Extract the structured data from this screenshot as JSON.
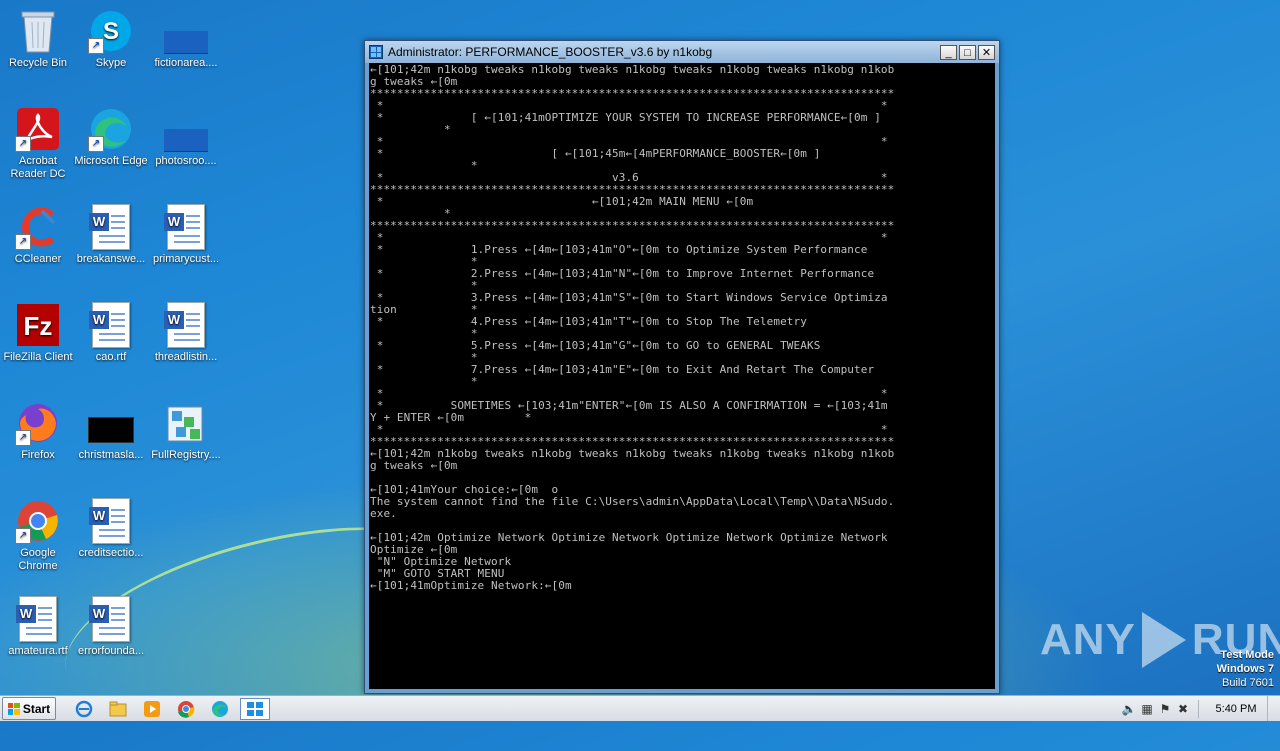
{
  "desktop": {
    "icons": [
      {
        "label": "Recycle Bin",
        "icon": "recycle-bin-icon"
      },
      {
        "label": "Skype",
        "icon": "skype-icon"
      },
      {
        "label": "fictionarea....",
        "icon": "blank-file-icon"
      },
      {
        "label": "Acrobat Reader DC",
        "icon": "acrobat-icon"
      },
      {
        "label": "Microsoft Edge",
        "icon": "edge-icon"
      },
      {
        "label": "photosroo....",
        "icon": "blank-file-icon"
      },
      {
        "label": "CCleaner",
        "icon": "ccleaner-icon"
      },
      {
        "label": "breakanswe...",
        "icon": "word-doc-icon"
      },
      {
        "label": "primarycust...",
        "icon": "word-doc-icon"
      },
      {
        "label": "FileZilla Client",
        "icon": "filezilla-icon"
      },
      {
        "label": "cao.rtf",
        "icon": "word-doc-icon"
      },
      {
        "label": "threadlistin...",
        "icon": "word-doc-icon"
      },
      {
        "label": "Firefox",
        "icon": "firefox-icon"
      },
      {
        "label": "christmasla...",
        "icon": "black-image-icon"
      },
      {
        "label": "FullRegistry....",
        "icon": "registry-icon"
      },
      {
        "label": "Google Chrome",
        "icon": "chrome-icon"
      },
      {
        "label": "creditsectio...",
        "icon": "word-doc-icon"
      },
      {
        "label": "amateura.rtf",
        "icon": "word-doc-icon"
      },
      {
        "label": "errorfounda...",
        "icon": "word-doc-icon"
      }
    ]
  },
  "window": {
    "title": "Administrator:  PERFORMANCE_BOOSTER_v3.6 by n1kobg",
    "minimize": "_",
    "maximize": "□",
    "close": "✕",
    "console_lines": [
      "←[101;42m n1kobg tweaks n1kobg tweaks n1kobg tweaks n1kobg tweaks n1kobg n1kob",
      "g tweaks ←[0m",
      "******************************************************************************",
      " *                                                                          *",
      " *             [ ←[101;41mOPTIMIZE YOUR SYSTEM TO INCREASE PERFORMANCE←[0m ]",
      "           *",
      " *                                                                          *",
      " *                         [ ←[101;45m←[4mPERFORMANCE_BOOSTER←[0m ]",
      "               *",
      " *                                  v3.6                                    *",
      "******************************************************************************",
      " *                               ←[101;42m MAIN MENU ←[0m",
      "           *",
      "******************************************************************************",
      " *                                                                          *",
      " *             1.Press ←[4m←[103;41m\"O\"←[0m to Optimize System Performance",
      "               *",
      " *             2.Press ←[4m←[103;41m\"N\"←[0m to Improve Internet Performance",
      "               *",
      " *             3.Press ←[4m←[103;41m\"S\"←[0m to Start Windows Service Optimiza",
      "tion           *",
      " *             4.Press ←[4m←[103;41m\"T\"←[0m to Stop The Telemetry",
      "               *",
      " *             5.Press ←[4m←[103;41m\"G\"←[0m to GO to GENERAL TWEAKS",
      "               *",
      " *             7.Press ←[4m←[103;41m\"E\"←[0m to Exit And Retart The Computer",
      "               *",
      " *                                                                          *",
      " *          SOMETIMES ←[103;41m\"ENTER\"←[0m IS ALSO A CONFIRMATION = ←[103;41m",
      "Y + ENTER ←[0m         *",
      " *                                                                          *",
      "******************************************************************************",
      "←[101;42m n1kobg tweaks n1kobg tweaks n1kobg tweaks n1kobg tweaks n1kobg n1kob",
      "g tweaks ←[0m",
      "",
      "←[101;41mYour choice:←[0m  o",
      "The system cannot find the file C:\\Users\\admin\\AppData\\Local\\Temp\\\\Data\\NSudo.",
      "exe.",
      "",
      "←[101;42m Optimize Network Optimize Network Optimize Network Optimize Network",
      "Optimize ←[0m",
      " \"N\" Optimize Network",
      " \"M\" GOTO START MENU",
      "←[101;41mOptimize Network:←[0m"
    ]
  },
  "watermark": {
    "left": "ANY",
    "right": "RUN"
  },
  "testmode": {
    "line1": "Test Mode",
    "line2": "Windows 7",
    "line3": "Build 7601"
  },
  "taskbar": {
    "start_label": "Start",
    "clock": "5:40 PM"
  }
}
